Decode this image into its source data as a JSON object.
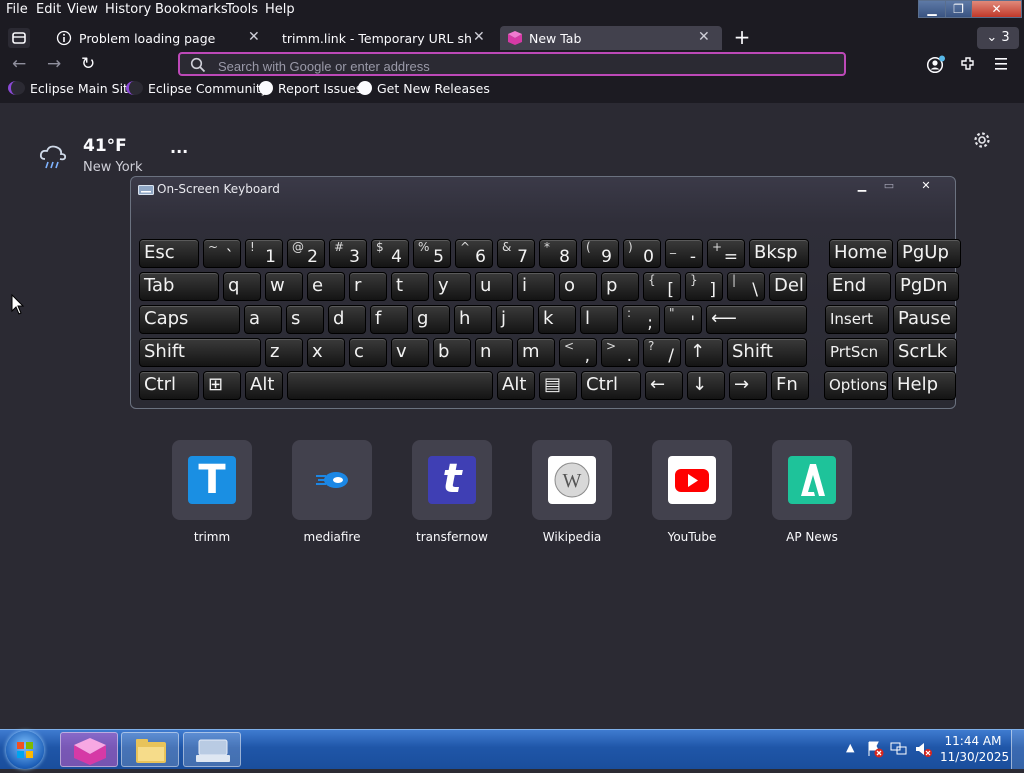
{
  "menubar": {
    "items": [
      "File",
      "Edit",
      "View",
      "History",
      "Bookmarks",
      "Tools",
      "Help"
    ]
  },
  "tabs": [
    {
      "label": "Problem loading page",
      "icon": "info-icon"
    },
    {
      "label": "trimm.link - Temporary URL shorten",
      "icon": ""
    },
    {
      "label": "New Tab",
      "icon": "firefox-devedition-icon",
      "active": true
    }
  ],
  "tab_count": "3",
  "urlbar": {
    "placeholder": "Search with Google or enter address"
  },
  "bookmarks": [
    {
      "label": "Eclipse Main Site",
      "icon": "eclipse-icon"
    },
    {
      "label": "Eclipse Community",
      "icon": "eclipse-icon"
    },
    {
      "label": "Report Issues",
      "icon": "github-icon"
    },
    {
      "label": "Get New Releases",
      "icon": "github-icon"
    }
  ],
  "weather": {
    "temperature": "41°F",
    "location": "New York",
    "icon": "rain-cloud-icon",
    "more": "···"
  },
  "osk": {
    "title": "On-Screen Keyboard",
    "rows": [
      [
        [
          "Esc"
        ],
        [
          "~",
          "`"
        ],
        [
          "!",
          "1"
        ],
        [
          "@",
          "2"
        ],
        [
          "#",
          "3"
        ],
        [
          "$",
          "4"
        ],
        [
          "%",
          "5"
        ],
        [
          "^",
          "6"
        ],
        [
          "&",
          "7"
        ],
        [
          "*",
          "8"
        ],
        [
          "(",
          "9"
        ],
        [
          ")",
          "0"
        ],
        [
          "_",
          "-"
        ],
        [
          "+",
          "="
        ],
        [
          "Bksp"
        ],
        [
          "Home"
        ],
        [
          "PgUp"
        ]
      ],
      [
        [
          "Tab"
        ],
        [
          "q"
        ],
        [
          "w"
        ],
        [
          "e"
        ],
        [
          "r"
        ],
        [
          "t"
        ],
        [
          "y"
        ],
        [
          "u"
        ],
        [
          "i"
        ],
        [
          "o"
        ],
        [
          "p"
        ],
        [
          "{",
          "["
        ],
        [
          "}",
          "]"
        ],
        [
          "|",
          "\\"
        ],
        [
          "Del"
        ],
        [
          "End"
        ],
        [
          "PgDn"
        ]
      ],
      [
        [
          "Caps"
        ],
        [
          "a"
        ],
        [
          "s"
        ],
        [
          "d"
        ],
        [
          "f"
        ],
        [
          "g"
        ],
        [
          "h"
        ],
        [
          "j"
        ],
        [
          "k"
        ],
        [
          "l"
        ],
        [
          ":",
          ";"
        ],
        [
          "\"",
          "'"
        ],
        [
          "⟵"
        ],
        [
          "Insert"
        ],
        [
          "Pause"
        ]
      ],
      [
        [
          "Shift"
        ],
        [
          "z"
        ],
        [
          "x"
        ],
        [
          "c"
        ],
        [
          "v"
        ],
        [
          "b"
        ],
        [
          "n"
        ],
        [
          "m"
        ],
        [
          "<",
          ","
        ],
        [
          ">",
          "."
        ],
        [
          "?",
          "/"
        ],
        [
          "↑"
        ],
        [
          "Shift"
        ],
        [
          "PrtScn"
        ],
        [
          "ScrLk"
        ]
      ],
      [
        [
          "Ctrl"
        ],
        [
          "⊞"
        ],
        [
          "Alt"
        ],
        [
          ""
        ],
        [
          "Alt"
        ],
        [
          "▤"
        ],
        [
          "Ctrl"
        ],
        [
          "←"
        ],
        [
          "↓"
        ],
        [
          "→"
        ],
        [
          "Fn"
        ],
        [
          "Options"
        ],
        [
          "Help"
        ]
      ]
    ]
  },
  "shortcuts": [
    {
      "label": "trimm",
      "logo_text": "T",
      "color": "#1a8fe3"
    },
    {
      "label": "mediafire",
      "logo_text": "",
      "color": "#42414d"
    },
    {
      "label": "transfernow",
      "logo_text": "t",
      "color": "#3f3fb4"
    },
    {
      "label": "Wikipedia",
      "logo_text": "W",
      "color": "#ffffff"
    },
    {
      "label": "YouTube",
      "logo_text": "▶",
      "color": "#ffffff"
    },
    {
      "label": "AP News",
      "logo_text": "A",
      "color": "#1ec39a"
    }
  ],
  "tray": {
    "time": "11:44 AM",
    "date": "11/30/2025"
  }
}
